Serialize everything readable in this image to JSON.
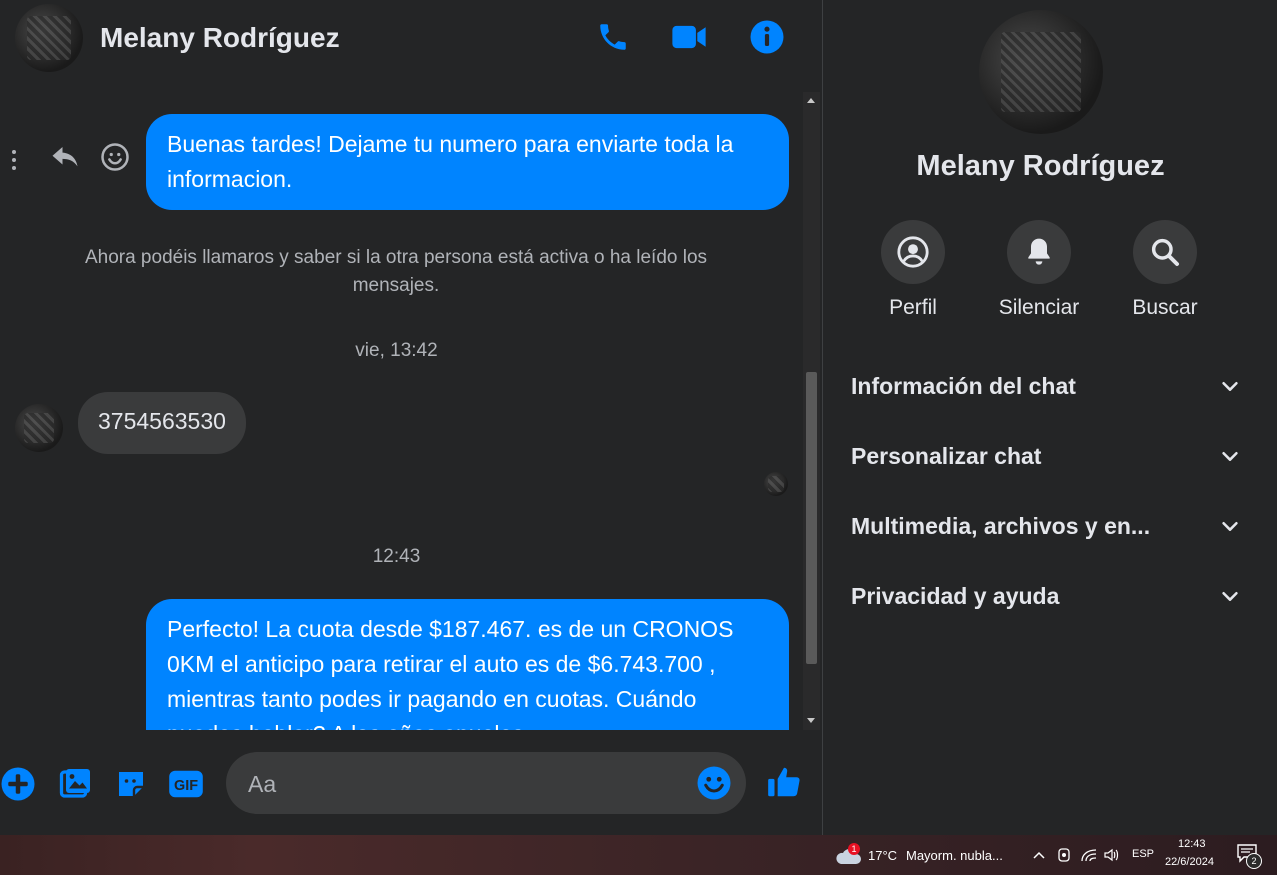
{
  "header": {
    "name": "Melany Rodríguez",
    "icons": [
      "phone-icon",
      "video-icon",
      "info-icon"
    ]
  },
  "messages": {
    "msg1": "Buenas tardes! Dejame tu numero para enviarte toda la informacion.",
    "system_note": "Ahora podéis llamaros y saber si la otra persona está activa o ha leído los mensajes.",
    "time1": "vie, 13:42",
    "msg2": "3754563530",
    "time2": "12:43",
    "msg3": "Perfecto! La cuota desde $187.467. es de un CRONOS 0KM el anticipo para retirar el auto es de $6.743.700 , mientras tanto podes ir pagando en cuotas. Cuándo puedes hablar? A los años anuales"
  },
  "composer": {
    "placeholder": "Aa"
  },
  "sidebar": {
    "name": "Melany Rodríguez",
    "actions": [
      {
        "label": "Perfil",
        "icon": "profile-icon"
      },
      {
        "label": "Silenciar",
        "icon": "bell-icon"
      },
      {
        "label": "Buscar",
        "icon": "search-icon"
      }
    ],
    "sections": [
      "Información del chat",
      "Personalizar chat",
      "Multimedia, archivos y en...",
      "Privacidad y ayuda"
    ]
  },
  "taskbar": {
    "weather_temp": "17°C",
    "weather_desc": "Mayorm. nubla...",
    "weather_badge": "1",
    "lang": "ESP",
    "time": "12:43",
    "date": "22/6/2024",
    "notif_count": "2"
  },
  "colors": {
    "accent": "#0084ff",
    "bg": "#242526",
    "bubble_in": "#3a3b3c"
  }
}
